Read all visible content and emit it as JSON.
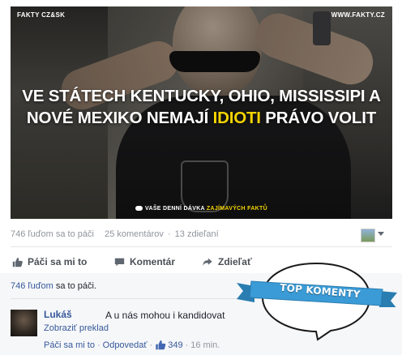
{
  "post": {
    "image": {
      "tag_left": "FAKTY CZ&SK",
      "tag_right": "WWW.FAKTY.CZ",
      "headline_part1": "VE STÁTECH KENTUCKY, OHIO, MISSISSIPI A NOVÉ MEXIKO NEMAJÍ ",
      "headline_highlight": "IDIOTI",
      "headline_part2": " PRÁVO VOLIT",
      "footer_part1": "VAŠE DENNÍ DÁVKA ",
      "footer_highlight": "ZAJÍMAVÝCH FAKTŮ",
      "accent_color": "#f5d400"
    },
    "stats": {
      "likes": "746 ľuďom sa to páči",
      "comments": "25 komentárov",
      "shares": "13 zdieľaní",
      "sep": "·"
    },
    "actions": {
      "like": "Páči sa mi to",
      "comment": "Komentár",
      "share": "Zdieľať"
    },
    "likes_summary": {
      "link": "746 ľuďom",
      "rest": " sa to páči."
    },
    "top_comments_badge": "TOP KOMENTY",
    "comment": {
      "author": "Lukáš",
      "text": "A u nás mohou i kandidovat",
      "translate": "Zobraziť preklad",
      "like_action": "Páči sa mi to",
      "reply_action": "Odpovedať",
      "like_count": "349",
      "time": "16 min.",
      "sep": "·"
    }
  }
}
